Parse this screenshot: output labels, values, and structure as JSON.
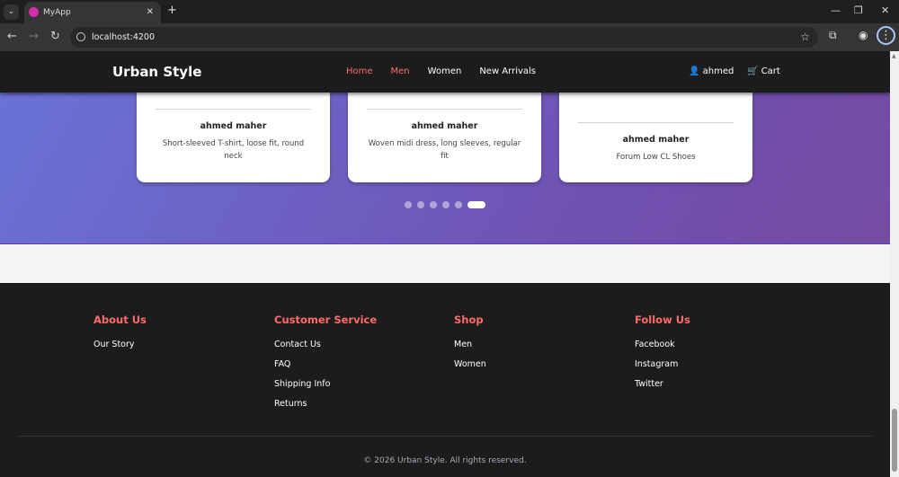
{
  "browser": {
    "tab_title": "MyApp",
    "url": "localhost:4200"
  },
  "header": {
    "brand": "Urban Style",
    "nav": [
      {
        "label": "Home"
      },
      {
        "label": "Men"
      },
      {
        "label": "Women"
      },
      {
        "label": "New Arrivals"
      }
    ],
    "user": "ahmed",
    "cart": "Cart"
  },
  "carousel": {
    "cards": [
      {
        "name": "ahmed maher",
        "desc": "Short-sleeved T-shirt, loose fit, round neck"
      },
      {
        "name": "ahmed maher",
        "desc": "Woven midi dress, long sleeves, regular fit"
      },
      {
        "name": "ahmed maher",
        "desc": "Forum Low CL Shoes"
      }
    ],
    "dot_count": 6,
    "active_dot": 6
  },
  "footer": {
    "columns": [
      {
        "title": "About Us",
        "links": [
          "Our Story"
        ]
      },
      {
        "title": "Customer Service",
        "links": [
          "Contact Us",
          "FAQ",
          "Shipping Info",
          "Returns"
        ]
      },
      {
        "title": "Shop",
        "links": [
          "Men",
          "Women"
        ]
      },
      {
        "title": "Follow Us",
        "links": [
          "Facebook",
          "Instagram",
          "Twitter"
        ]
      }
    ],
    "copyright": "© 2026 Urban Style. All rights reserved."
  },
  "colors": {
    "accent": "#ff6b6b",
    "hero_start": "#6a72d6",
    "hero_end": "#764ba2"
  }
}
